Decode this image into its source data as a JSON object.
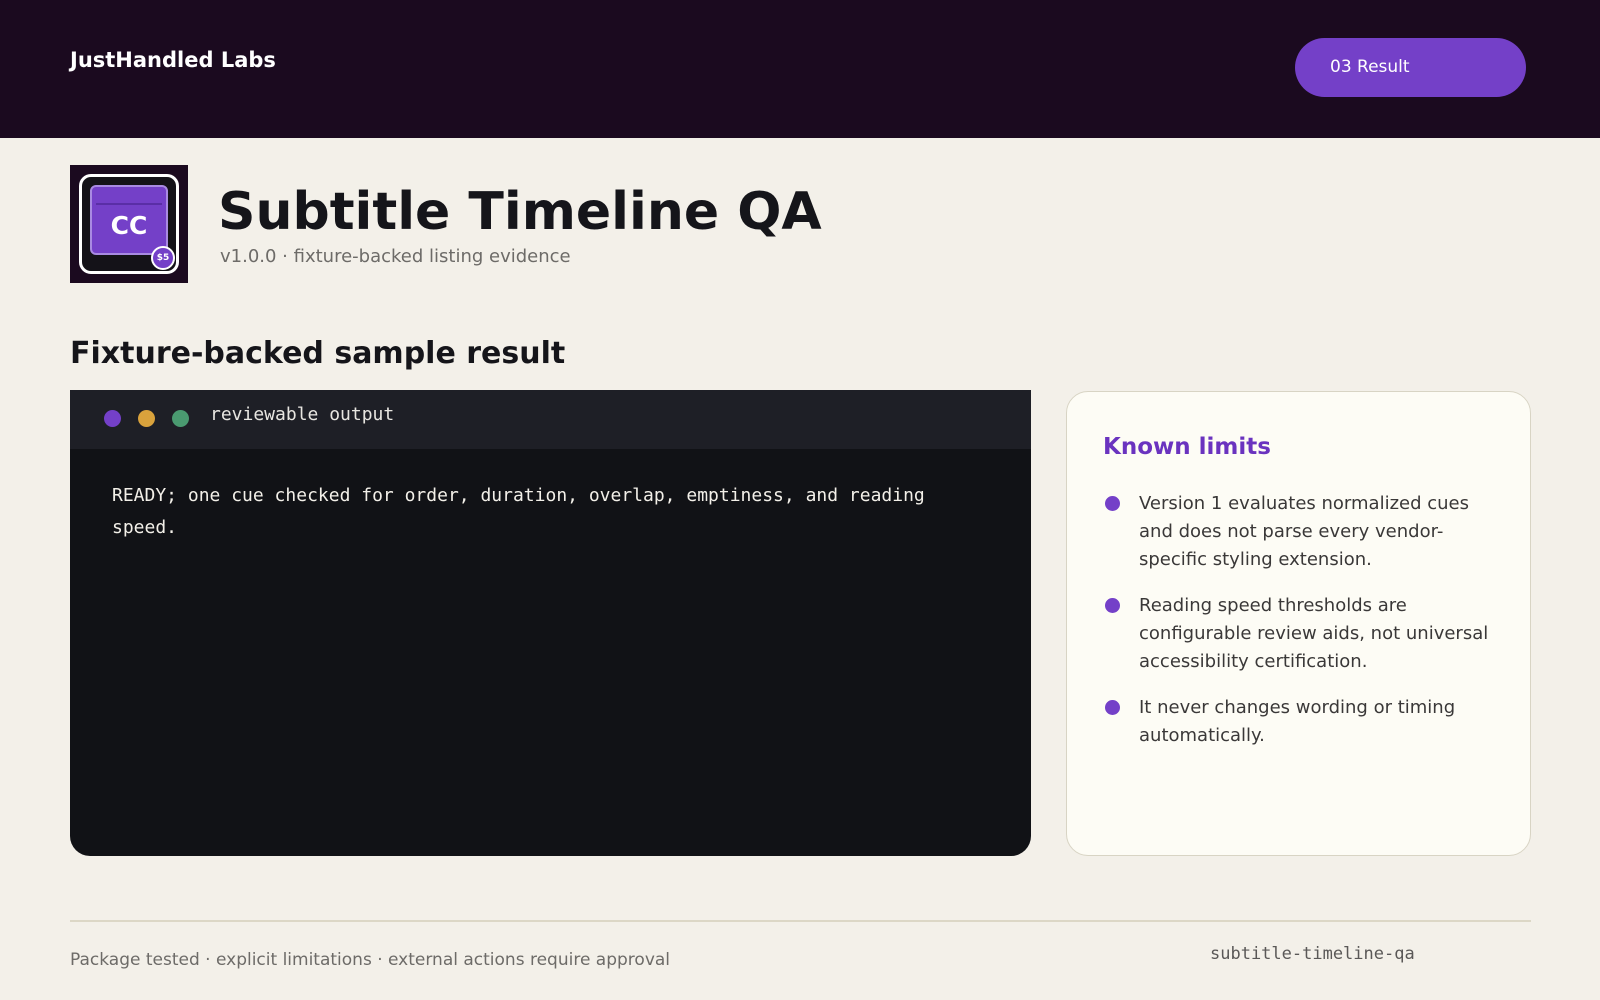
{
  "header": {
    "brand": "JustHandled Labs",
    "step_label": "03 Result"
  },
  "app": {
    "icon_text": "CC",
    "price_badge": "$5",
    "title": "Subtitle Timeline QA",
    "subtitle": "v1.0.0 · fixture-backed listing evidence"
  },
  "section": {
    "title": "Fixture-backed sample result"
  },
  "terminal": {
    "label": "reviewable output",
    "output": "READY; one cue checked for order, duration, overlap, emptiness, and reading speed."
  },
  "limits": {
    "title": "Known limits",
    "items": [
      "Version 1 evaluates normalized cues and does not parse every vendor-specific styling extension.",
      "Reading speed thresholds are configurable review aids, not universal accessibility certification.",
      "It never changes wording or timing automatically."
    ]
  },
  "footer": {
    "note": "Package tested · explicit limitations · external actions require approval",
    "slug": "subtitle-timeline-qa"
  },
  "colors": {
    "header_bg": "#1b0a1f",
    "accent": "#7440c8",
    "page_bg": "#f3f0e9",
    "terminal_bg": "#111216",
    "dot_purple": "#7440c8",
    "dot_yellow": "#d9a23c",
    "dot_green": "#4a9a70"
  }
}
